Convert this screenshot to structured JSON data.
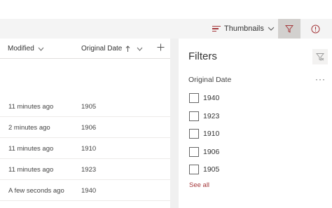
{
  "toolbar": {
    "view_label": "Thumbnails",
    "accent": "#a4373a",
    "filter_active_bg": "#d2d0ce"
  },
  "list": {
    "columns": [
      {
        "label": "Modified",
        "icon": "chevron-down-icon"
      },
      {
        "label": "Original Date",
        "icon": "sort-ascending-arrow-icon"
      }
    ],
    "add_column_icon": "plus-icon",
    "rows": [
      {
        "modified": "11 minutes ago",
        "original_date": "1905"
      },
      {
        "modified": "2 minutes ago",
        "original_date": "1906"
      },
      {
        "modified": "11 minutes ago",
        "original_date": "1910"
      },
      {
        "modified": "11 minutes ago",
        "original_date": "1923"
      },
      {
        "modified": "A few seconds ago",
        "original_date": "1940"
      }
    ]
  },
  "filters": {
    "title": "Filters",
    "group_title": "Original Date",
    "options": [
      "1940",
      "1923",
      "1910",
      "1906",
      "1905"
    ],
    "see_all": "See all"
  }
}
